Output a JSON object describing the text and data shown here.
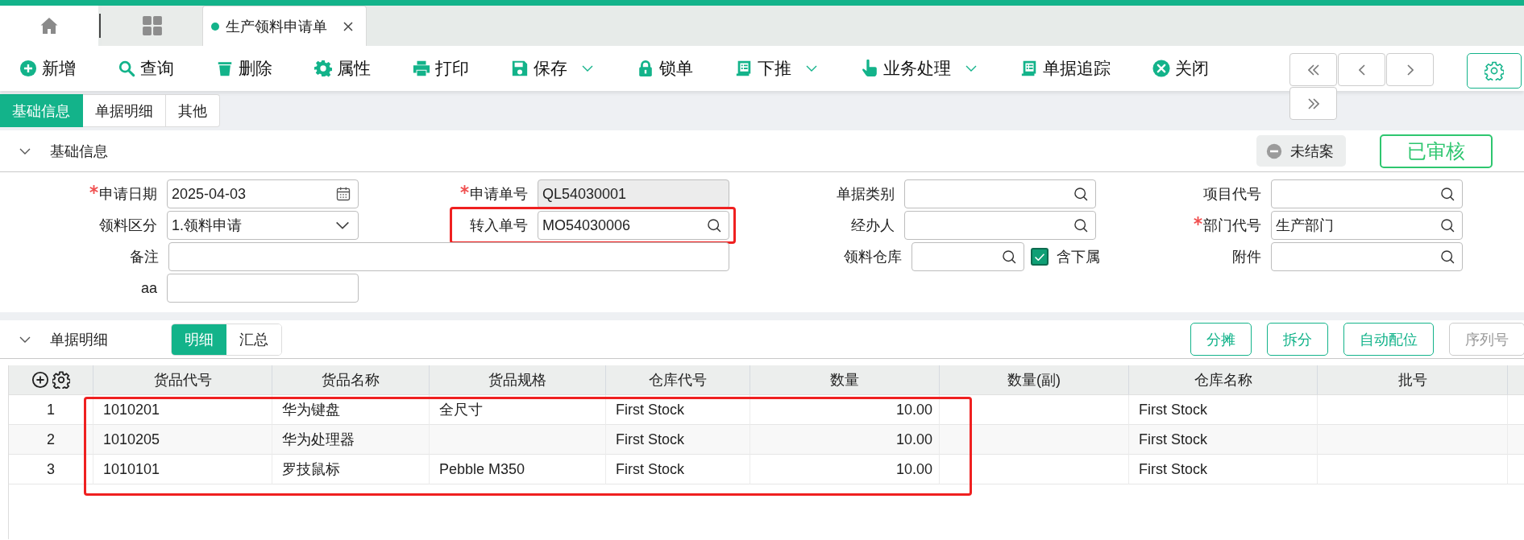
{
  "top_tabs": [
    {
      "label": "生产领料申请单",
      "selected": true
    }
  ],
  "toolbar": [
    {
      "label": "新增",
      "dropdown": false
    },
    {
      "label": "查询",
      "dropdown": false
    },
    {
      "label": "删除",
      "dropdown": false
    },
    {
      "label": "属性",
      "dropdown": false
    },
    {
      "label": "打印",
      "dropdown": false
    },
    {
      "label": "保存",
      "dropdown": true
    },
    {
      "label": "锁单",
      "dropdown": false
    },
    {
      "label": "下推",
      "dropdown": true
    },
    {
      "label": "业务处理",
      "dropdown": true
    },
    {
      "label": "单据追踪",
      "dropdown": false
    },
    {
      "label": "关闭",
      "dropdown": false
    }
  ],
  "view_tabs": [
    {
      "label": "基础信息",
      "selected": true
    },
    {
      "label": "单据明细",
      "selected": false
    },
    {
      "label": "其他",
      "selected": false
    }
  ],
  "basic_info": {
    "title": "基础信息",
    "expanded": true,
    "status_badge": "未结案",
    "approval_stamp": "已审核",
    "rows": [
      [
        {
          "label": "申请日期",
          "required": true,
          "kind": "date",
          "value": "2025-04-03",
          "highlighted": false
        },
        {
          "label": "申请单号",
          "required": true,
          "kind": "readonly",
          "value": "QL54030001",
          "highlighted": false
        },
        {
          "label": "单据类别",
          "required": false,
          "kind": "lookup",
          "highlighted": false
        },
        {
          "label": "项目代号",
          "required": false,
          "kind": "lookup",
          "highlighted": false
        }
      ],
      [
        {
          "label": "领料区分",
          "required": false,
          "kind": "select",
          "value": "1.领料申请",
          "highlighted": false
        },
        {
          "label": "转入单号",
          "required": false,
          "kind": "lookup",
          "value": "MO54030006",
          "highlighted": true
        },
        {
          "label": "经办人",
          "required": false,
          "kind": "lookup",
          "highlighted": false
        },
        {
          "label": "部门代号",
          "required": true,
          "kind": "lookup",
          "value": "生产部门",
          "highlighted": false
        }
      ],
      [
        {
          "label": "备注",
          "required": false,
          "kind": "memo",
          "highlighted": false
        },
        "",
        {
          "label": "领料仓库",
          "required": false,
          "kind": "lookup",
          "highlighted": false,
          "option": {
            "label": "含下属",
            "checked": true
          }
        },
        {
          "label": "附件",
          "required": false,
          "kind": "lookup",
          "highlighted": false
        }
      ],
      [
        {
          "label": "aa",
          "required": false,
          "kind": "text",
          "highlighted": false
        }
      ]
    ]
  },
  "detail": {
    "title": "单据明细",
    "expanded": true,
    "view_toggle": [
      {
        "label": "明细",
        "selected": true
      },
      {
        "label": "汇总",
        "selected": false
      }
    ],
    "actions": [
      {
        "label": "分摊",
        "disabled": false
      },
      {
        "label": "拆分",
        "disabled": false
      },
      {
        "label": "自动配位",
        "disabled": false
      },
      {
        "label": "序列号",
        "disabled": true
      }
    ],
    "table": {
      "columns": [
        {
          "label": "货品代号",
          "kind": "text",
          "highlighted": true
        },
        {
          "label": "货品名称",
          "kind": "text",
          "highlighted": true
        },
        {
          "label": "货品规格",
          "kind": "text",
          "highlighted": true
        },
        {
          "label": "仓库代号",
          "kind": "text",
          "highlighted": true
        },
        {
          "label": "数量",
          "kind": "number",
          "highlighted": true
        },
        {
          "label": "数量(副)",
          "kind": "number",
          "highlighted": false
        },
        {
          "label": "仓库名称",
          "kind": "text",
          "highlighted": false
        },
        {
          "label": "批号",
          "kind": "text",
          "highlighted": false
        }
      ],
      "rows": [
        {
          "number": "1",
          "cells": [
            "1010201",
            "华为键盘",
            "全尺寸",
            "First Stock",
            "10.00",
            "",
            "First Stock",
            ""
          ]
        },
        {
          "number": "2",
          "cells": [
            "1010205",
            "华为处理器",
            "",
            "First Stock",
            "10.00",
            "",
            "First Stock",
            ""
          ]
        },
        {
          "number": "3",
          "cells": [
            "1010101",
            "罗技鼠标",
            "Pebble M350",
            "First Stock",
            "10.00",
            "",
            "First Stock",
            ""
          ]
        }
      ]
    }
  }
}
